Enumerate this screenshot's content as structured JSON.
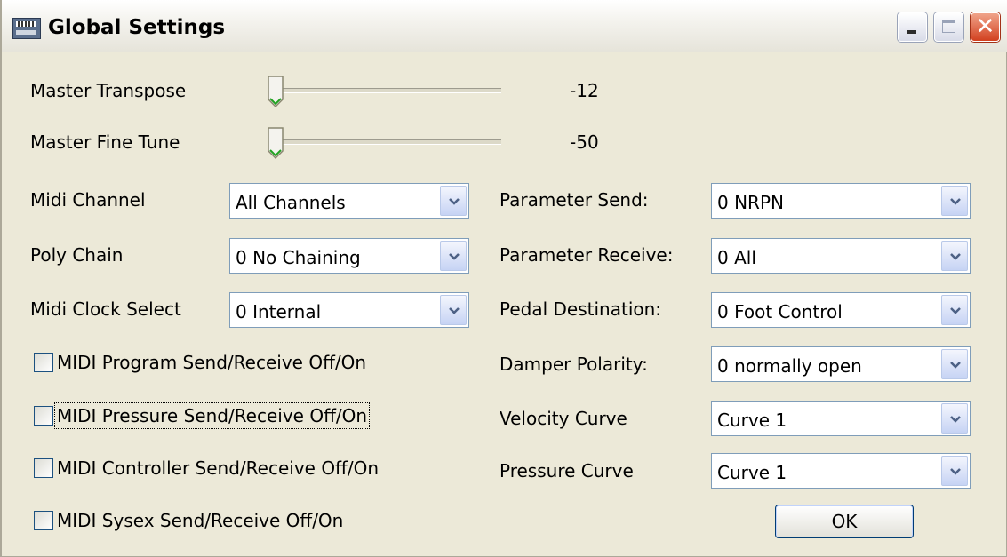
{
  "window": {
    "title": "Global Settings",
    "controls": [
      "minimize-icon",
      "maximize-icon",
      "close-icon"
    ]
  },
  "sliders": [
    {
      "label": "Master Transpose",
      "value": "-12",
      "position": 0.0
    },
    {
      "label": "Master Fine Tune",
      "value": "-50",
      "position": 0.0
    }
  ],
  "left_selects": [
    {
      "label": "Midi Channel",
      "value": "All Channels"
    },
    {
      "label": "Poly Chain",
      "value": "0 No Chaining"
    },
    {
      "label": "Midi Clock Select",
      "value": "0 Internal"
    }
  ],
  "checkboxes": [
    {
      "label": "MIDI Program Send/Receive Off/On",
      "checked": false
    },
    {
      "label": "MIDI Pressure Send/Receive Off/On",
      "checked": false,
      "focused": true
    },
    {
      "label": "MIDI Controller Send/Receive Off/On",
      "checked": false
    },
    {
      "label": "MIDI Sysex Send/Receive Off/On",
      "checked": false
    }
  ],
  "right_selects": [
    {
      "label": "Parameter Send:",
      "value": "0 NRPN"
    },
    {
      "label": "Parameter Receive:",
      "value": "0 All"
    },
    {
      "label": "Pedal Destination:",
      "value": "0 Foot Control"
    },
    {
      "label": "Damper Polarity:",
      "value": "0 normally open"
    },
    {
      "label": "Velocity Curve",
      "value": "Curve 1"
    },
    {
      "label": "Pressure Curve",
      "value": "Curve 1"
    }
  ],
  "ok_label": "OK",
  "colors": {
    "dialog_bg": "#ece9d8",
    "combo_border": "#7f9db9",
    "close_button": "#d2401f",
    "button_border": "#003c74"
  }
}
